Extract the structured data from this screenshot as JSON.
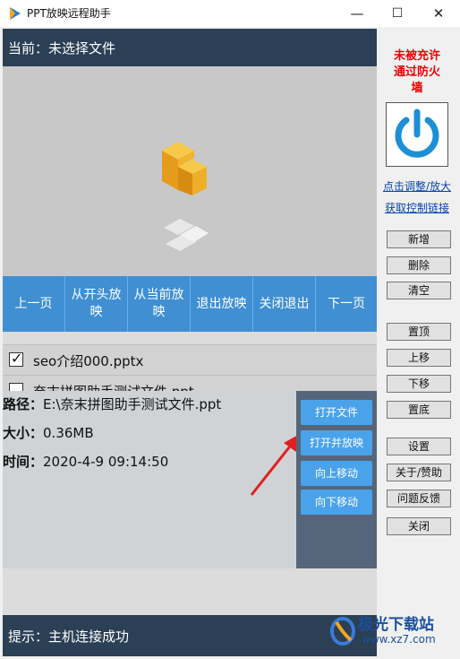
{
  "window": {
    "title": "PPT放映远程助手",
    "minimize": "—",
    "maximize": "☐",
    "close": "✕"
  },
  "header": {
    "current": "当前：未选择文件"
  },
  "nav": [
    "上一页",
    "从开头放映",
    "从当前放映",
    "退出放映",
    "关闭退出",
    "下一页"
  ],
  "files": [
    {
      "name": "seo介绍000.pptx",
      "checked": true
    },
    {
      "name": "奈末拼图助手测试文件.ppt",
      "checked": false
    }
  ],
  "info": {
    "path_label": "路径：",
    "path_value": "E:\\奈末拼图助手测试文件.ppt",
    "size_label": "大小：",
    "size_value": "0.36MB",
    "time_label": "时间：",
    "time_value": "2020-4-9 09:14:50"
  },
  "actions": [
    "打开文件",
    "打开并放映",
    "向上移动",
    "向下移动"
  ],
  "status": "提示：主机连接成功",
  "firewall": {
    "line1": "未被充许",
    "line2": "通过防火",
    "line3": "墙"
  },
  "links": {
    "zoom": "点击调整/放大",
    "get_link": "获取控制链接"
  },
  "side_buttons": {
    "add": "新增",
    "delete": "删除",
    "clear": "清空",
    "top": "置顶",
    "up": "上移",
    "down": "下移",
    "bottom": "置底",
    "settings": "设置",
    "about": "关于/赞助",
    "feedback": "问题反馈",
    "close": "关闭"
  },
  "watermark": {
    "brand": "极光下载站",
    "url": "www.xz7.com"
  },
  "colors": {
    "accent": "#3f8fd2",
    "dark_bar": "#2b3f55",
    "power_icon": "#1e8fd6",
    "warning": "#ee0000"
  }
}
